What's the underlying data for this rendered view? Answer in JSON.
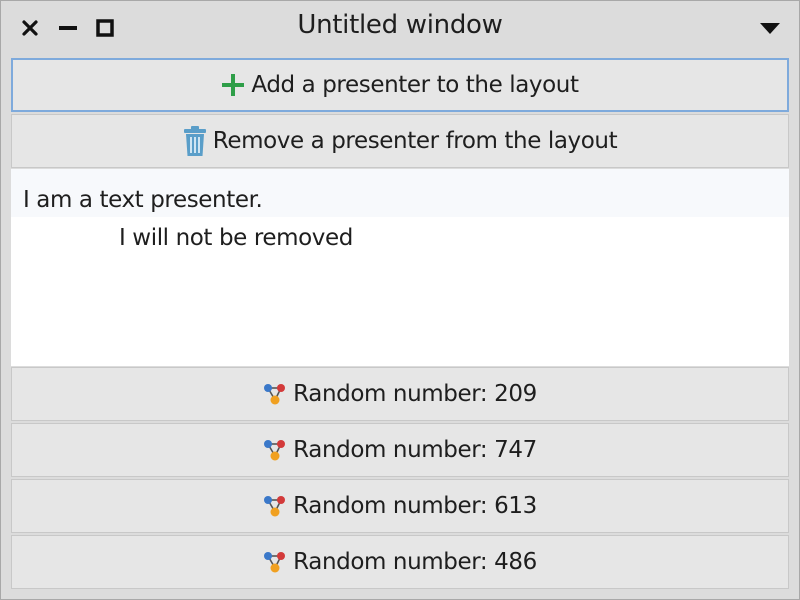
{
  "window": {
    "title": "Untitled window"
  },
  "icons": {
    "close": "close-icon",
    "minimize": "minimize-icon",
    "maximize": "maximize-icon",
    "menu": "chevron-down-icon",
    "add": "plus-icon",
    "remove": "trash-icon",
    "random": "graph-nodes-icon"
  },
  "colors": {
    "add_icon": "#2e9e48",
    "trash_icon": "#5a9ec9",
    "focus_border": "#7eaadc"
  },
  "buttons": {
    "add_label": "Add a presenter to the layout",
    "remove_label": "Remove a presenter from the layout"
  },
  "text_presenter": {
    "line1": "I am a text presenter.",
    "line2": "I will not be removed"
  },
  "random_buttons": [
    {
      "label": "Random number: 209"
    },
    {
      "label": "Random number: 747"
    },
    {
      "label": "Random number: 613"
    },
    {
      "label": "Random number: 486"
    }
  ]
}
